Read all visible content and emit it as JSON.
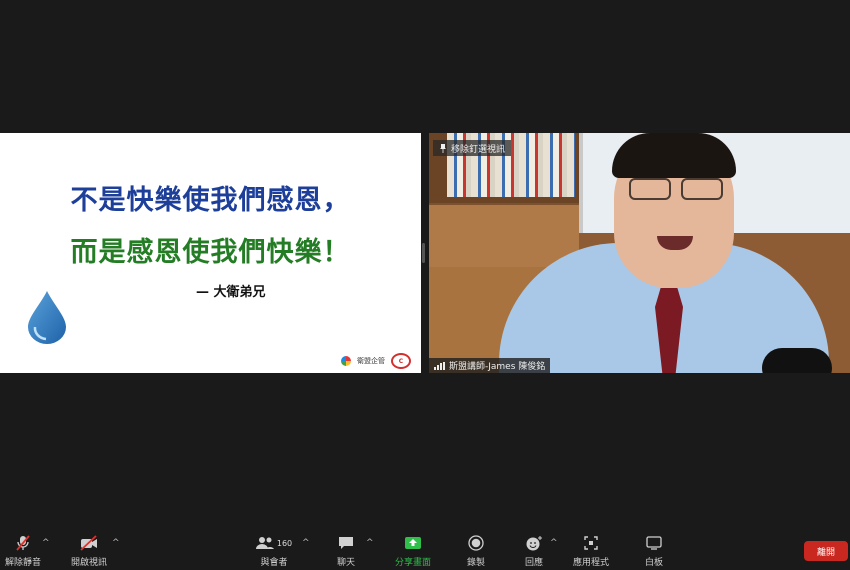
{
  "slide": {
    "line1": "不是快樂使我們感恩，",
    "line2": "而是感恩使我們快樂！",
    "author": "— 大衛弟兄",
    "logo_text": "衛盟企管"
  },
  "video": {
    "pin_label": "移除釘選視訊",
    "participant_name": "斯盟講師-James 陳俊銘"
  },
  "toolbar": {
    "mute_label": "解除靜音",
    "video_label": "開啟視訊",
    "participants_label": "與會者",
    "participants_count": "160",
    "chat_label": "聊天",
    "share_label": "分享畫面",
    "record_label": "錄製",
    "reactions_label": "回應",
    "apps_label": "應用程式",
    "whiteboard_label": "白板",
    "leave_label": "離開"
  },
  "colors": {
    "line1": "#1d3f9a",
    "line2": "#247d25",
    "share_green": "#2fbf4a",
    "leave_red": "#c8281f"
  }
}
